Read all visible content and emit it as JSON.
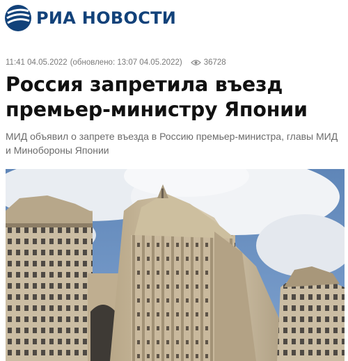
{
  "brand": {
    "name": "РИА НОВОСТИ",
    "color": "#12427a"
  },
  "article": {
    "published": "11:41 04.05.2022",
    "updated": "(обновлено: 13:07 04.05.2022)",
    "views": "36728",
    "title": "Россия запретила въезд премьер-министру Японии",
    "lead": "МИД объявил о запрете въезда в Россию премьер-министра, главы МИД и Минобороны Японии"
  },
  "icons": {
    "views": "eye-icon",
    "logo": "ria-logo-icon"
  }
}
